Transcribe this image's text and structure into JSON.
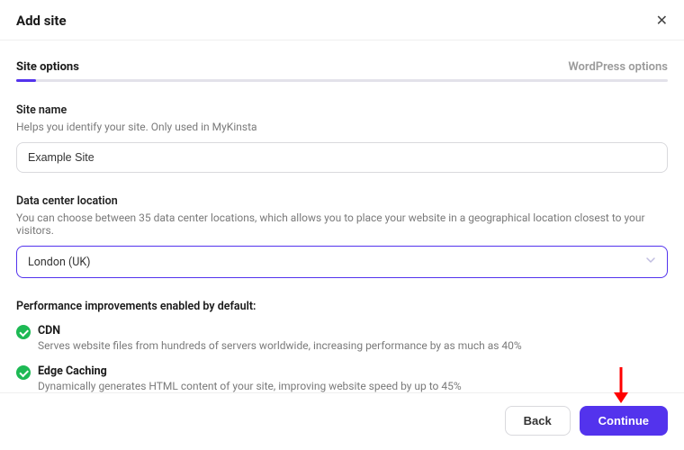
{
  "header": {
    "title": "Add site"
  },
  "tabs": {
    "left": "Site options",
    "right": "WordPress options"
  },
  "siteName": {
    "label": "Site name",
    "help": "Helps you identify your site. Only used in MyKinsta",
    "value": "Example Site"
  },
  "dataCenter": {
    "label": "Data center location",
    "help": "You can choose between 35 data center locations, which allows you to place your website in a geographical location closest to your visitors.",
    "value": "London (UK)"
  },
  "performance": {
    "title": "Performance improvements enabled by default:",
    "items": [
      {
        "name": "CDN",
        "desc": "Serves website files from hundreds of servers worldwide, increasing performance by as much as 40%"
      },
      {
        "name": "Edge Caching",
        "desc": "Dynamically generates HTML content of your site, improving website speed by up to 45%"
      }
    ]
  },
  "footer": {
    "back": "Back",
    "continue": "Continue"
  }
}
